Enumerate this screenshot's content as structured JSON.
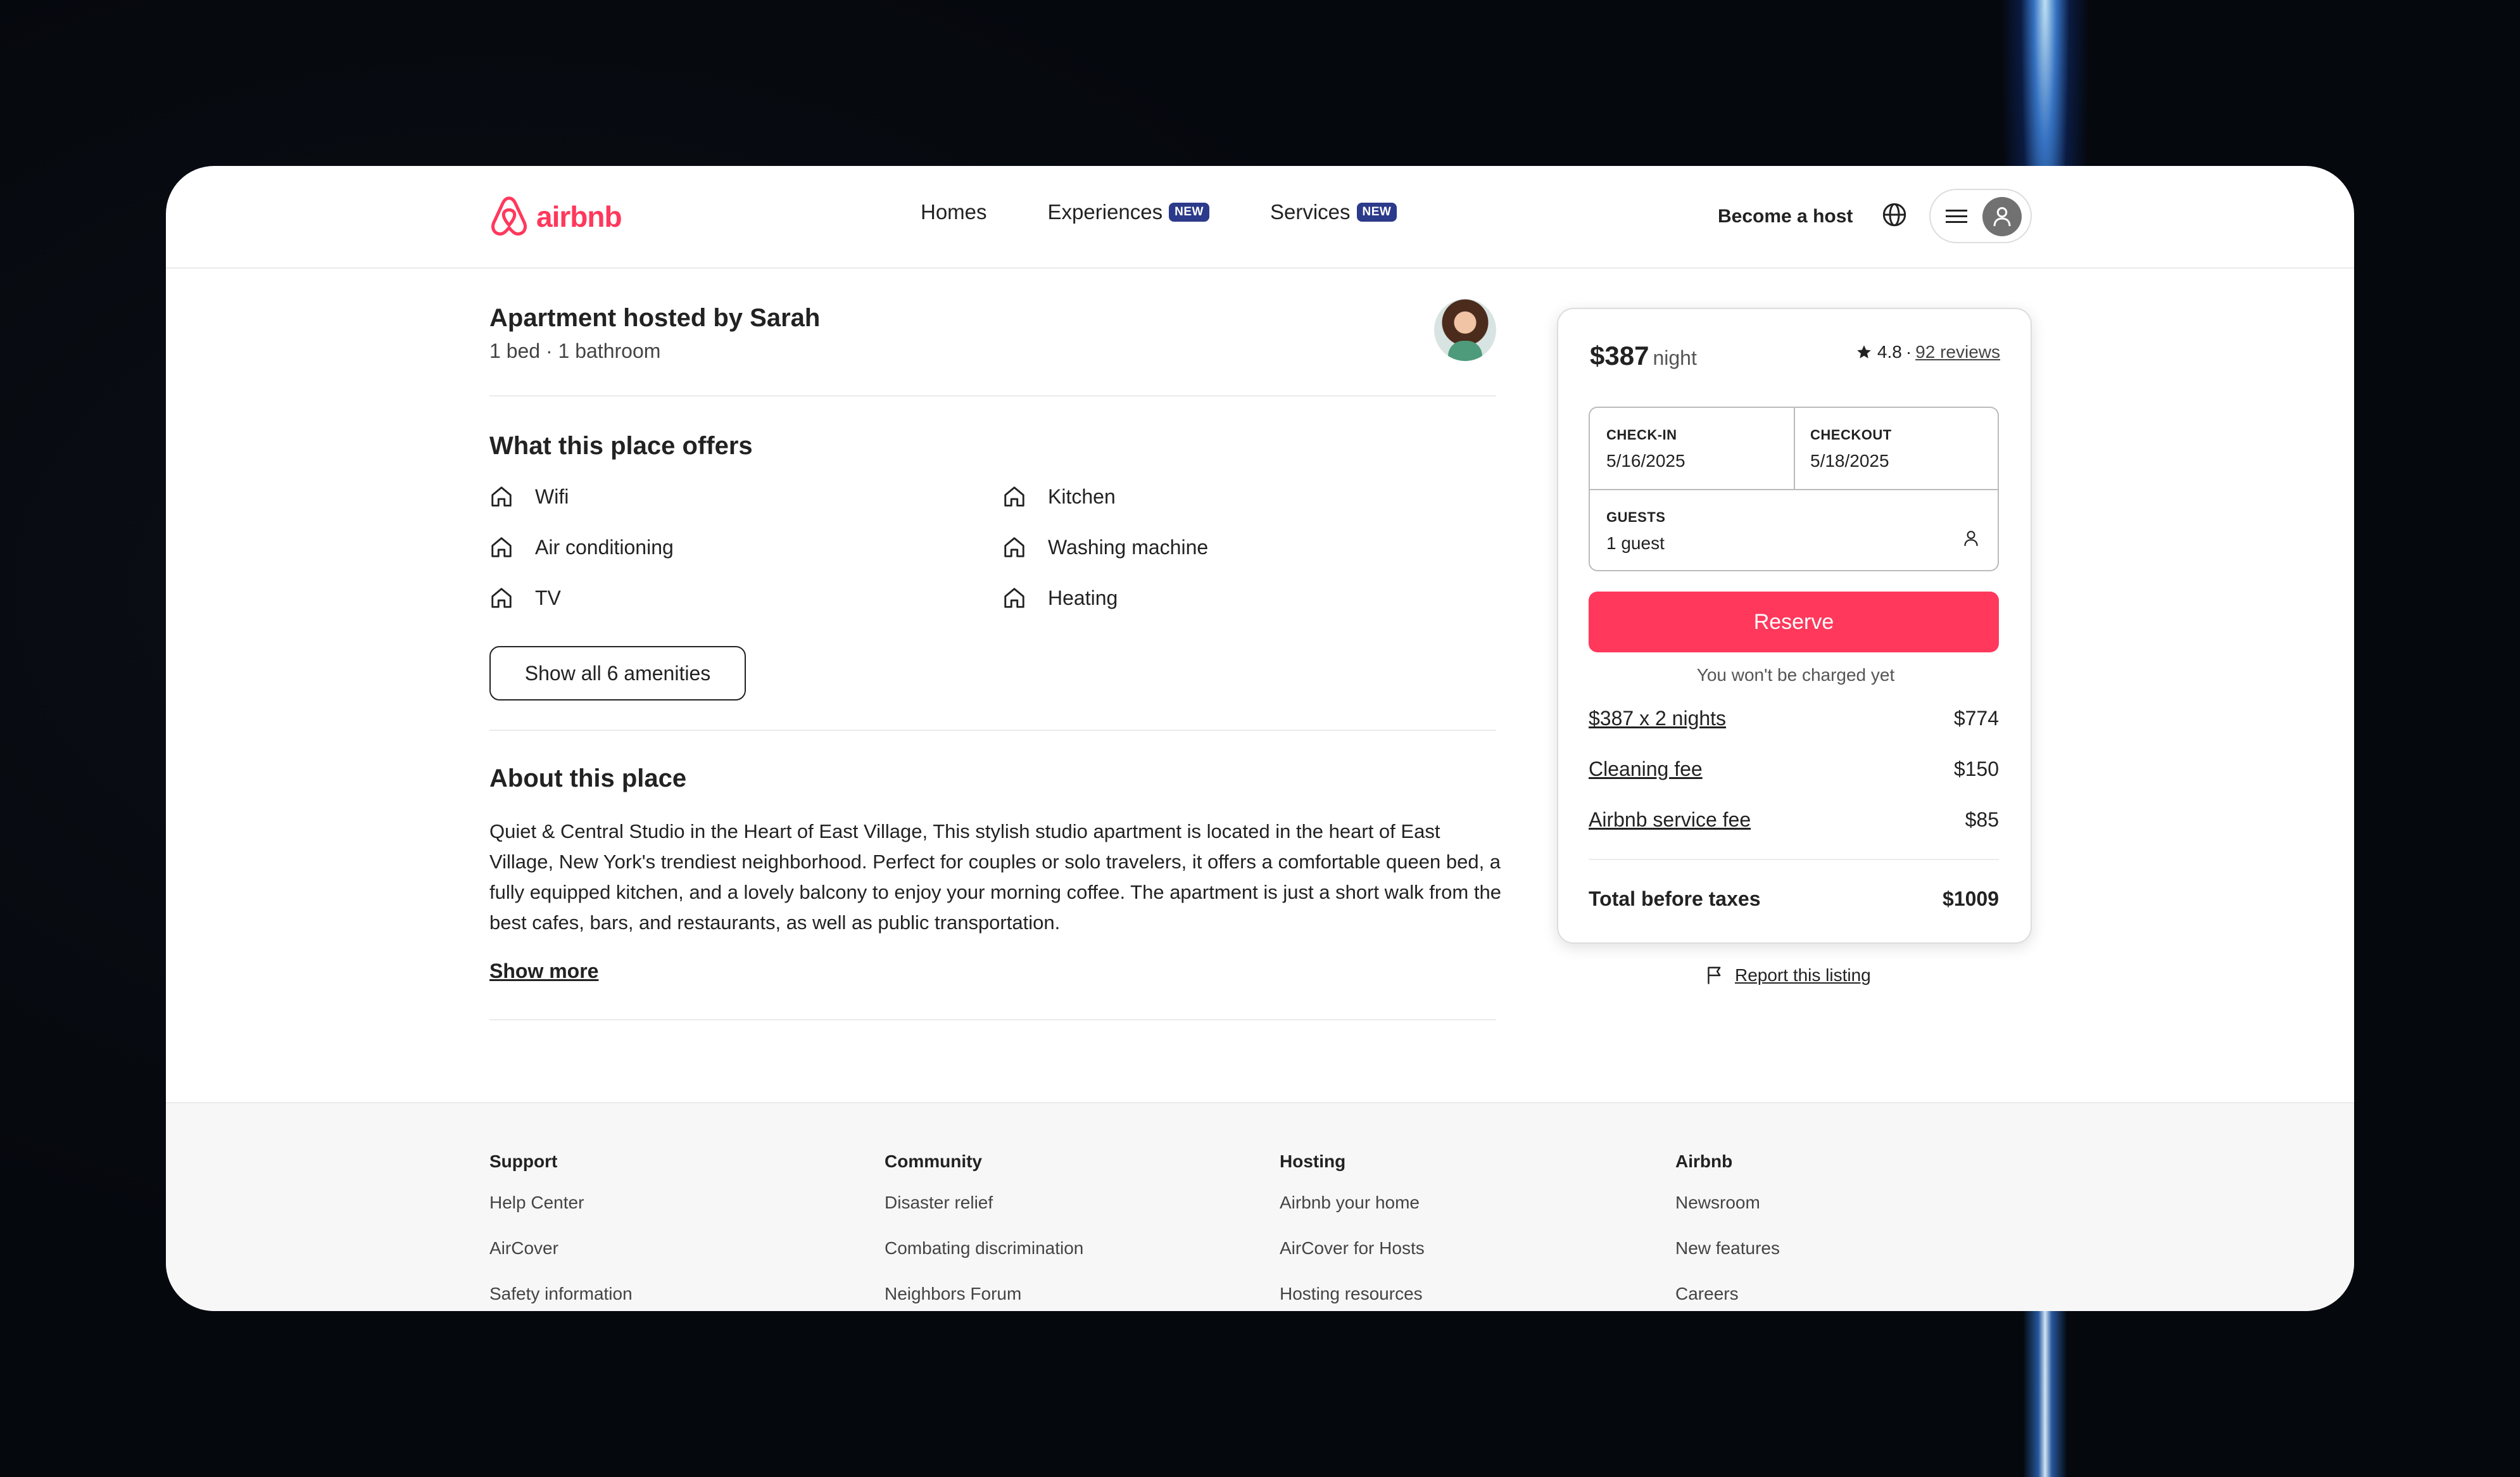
{
  "header": {
    "logo_text": "airbnb",
    "nav": [
      {
        "label": "Homes",
        "badge": ""
      },
      {
        "label": "Experiences",
        "badge": "NEW"
      },
      {
        "label": "Services",
        "badge": "NEW"
      }
    ],
    "become_host": "Become a host"
  },
  "listing": {
    "title": "Apartment hosted by Sarah",
    "subtitle": "1 bed · 1 bathroom"
  },
  "amenities": {
    "title": "What this place offers",
    "items": [
      "Wifi",
      "Kitchen",
      "Air conditioning",
      "Washing machine",
      "TV",
      "Heating"
    ],
    "show_all": "Show all 6 amenities",
    "icon": "home-icon"
  },
  "about": {
    "title": "About this place",
    "text": "Quiet & Central Studio in the Heart of East Village, This stylish studio apartment is located in the heart of East Village, New York's trendiest neighborhood. Perfect for couples or solo travelers, it offers a comfortable queen bed, a fully equipped kitchen, and a lovely balcony to enjoy your morning coffee. The apartment is just a short walk from the best cafes, bars, and restaurants, as well as public transportation.",
    "show_more": "Show more"
  },
  "booking": {
    "price": "$387",
    "price_unit": "night",
    "rating": "4.8",
    "separator": "·",
    "reviews": "92 reviews",
    "checkin_label": "CHECK-IN",
    "checkin_value": "5/16/2025",
    "checkout_label": "CHECKOUT",
    "checkout_value": "5/18/2025",
    "guests_label": "GUESTS",
    "guests_value": "1 guest",
    "reserve": "Reserve",
    "not_charged": "You won't be charged yet",
    "fees": [
      {
        "label": "$387 x 2 nights",
        "amount": "$774"
      },
      {
        "label": "Cleaning fee",
        "amount": "$150"
      },
      {
        "label": "Airbnb service fee",
        "amount": "$85"
      }
    ],
    "total_label": "Total before taxes",
    "total_amount": "$1009"
  },
  "report": "Report this listing",
  "footer": {
    "columns": [
      {
        "title": "Support",
        "links": [
          "Help Center",
          "AirCover",
          "Safety information"
        ]
      },
      {
        "title": "Community",
        "links": [
          "Disaster relief",
          "Combating discrimination",
          "Neighbors Forum"
        ]
      },
      {
        "title": "Hosting",
        "links": [
          "Airbnb your home",
          "AirCover for Hosts",
          "Hosting resources"
        ]
      },
      {
        "title": "Airbnb",
        "links": [
          "Newsroom",
          "New features",
          "Careers"
        ]
      }
    ]
  },
  "colors": {
    "brand": "#ff385c",
    "badge": "#2b3a8a",
    "text": "#222222"
  }
}
